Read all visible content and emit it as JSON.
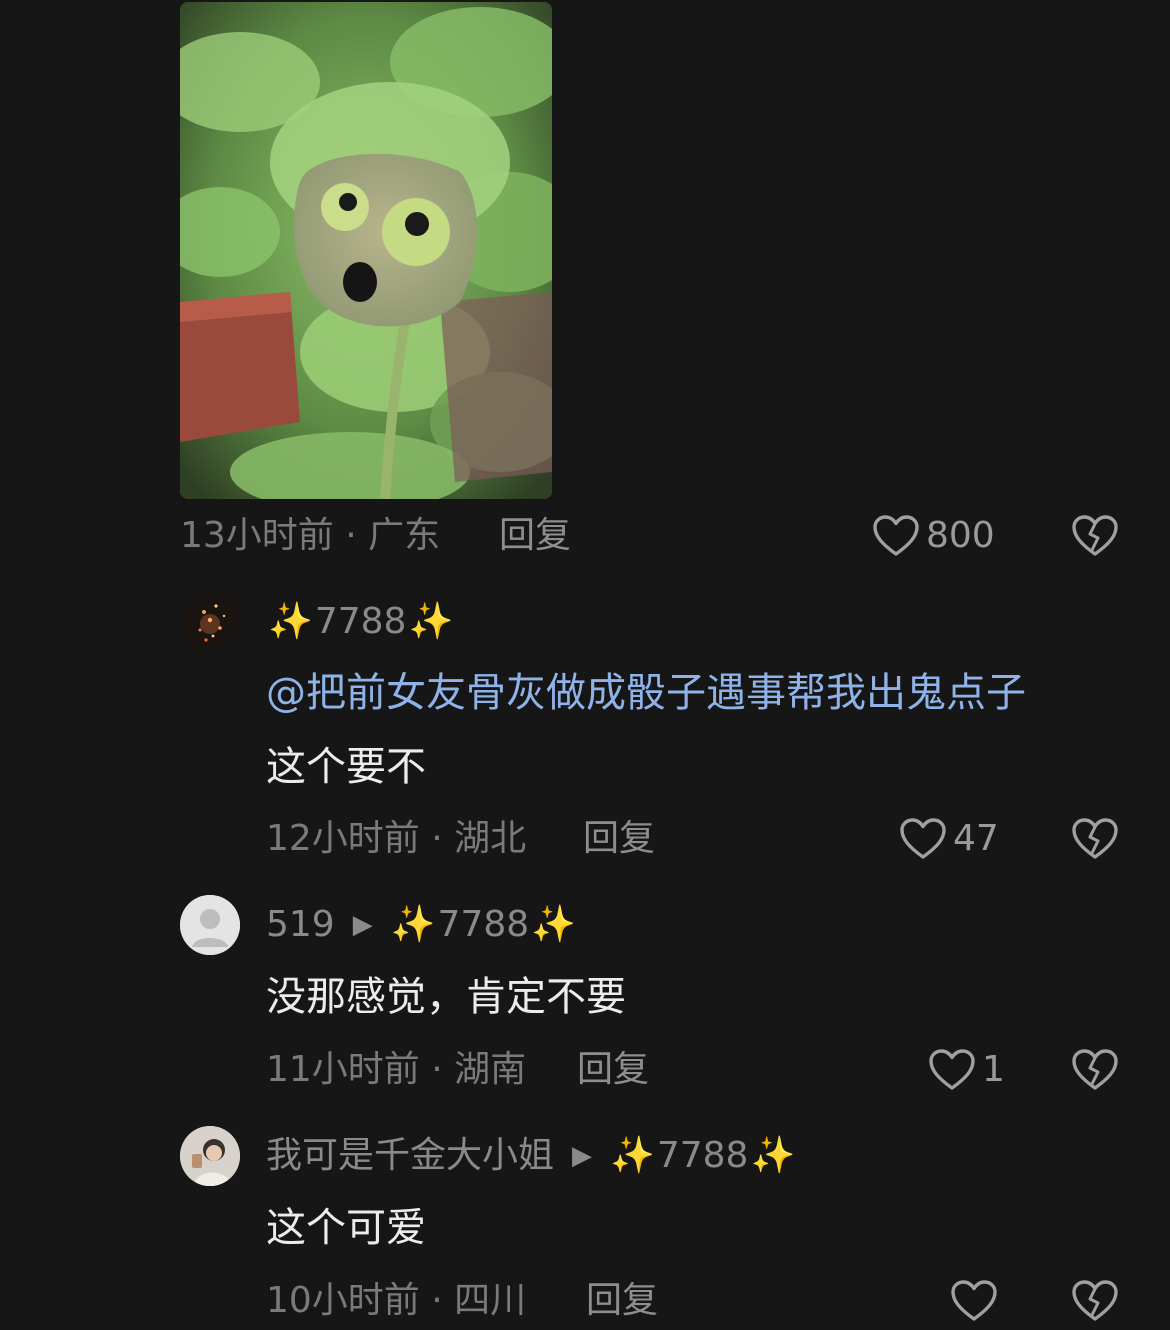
{
  "comment_top": {
    "meta": "13小时前 · 广东",
    "reply_label": "回复",
    "like_count": "800"
  },
  "comments": [
    {
      "username": "7788",
      "mention": "@把前女友骨灰做成骰子遇事帮我出鬼点子",
      "text": "这个要不",
      "meta": "12小时前 · 湖北",
      "reply_label": "回复",
      "like_count": "47"
    },
    {
      "username": "519",
      "reply_to": "7788",
      "text": "没那感觉，肯定不要",
      "meta": "11小时前 · 湖南",
      "reply_label": "回复",
      "like_count": "1"
    },
    {
      "username": "我可是千金大小姐",
      "reply_to": "7788",
      "text": "这个可爱",
      "meta": "10小时前 · 四川",
      "reply_label": "回复",
      "like_count": ""
    }
  ],
  "sparkle_glyph": "✨",
  "reply_arrow_glyph": "▶",
  "icons": {
    "like": "heart-outline-icon",
    "dislike": "broken-heart-icon"
  },
  "colors": {
    "background": "#161616",
    "mention": "#8fb3e8",
    "meta": "#7a7a7a"
  }
}
